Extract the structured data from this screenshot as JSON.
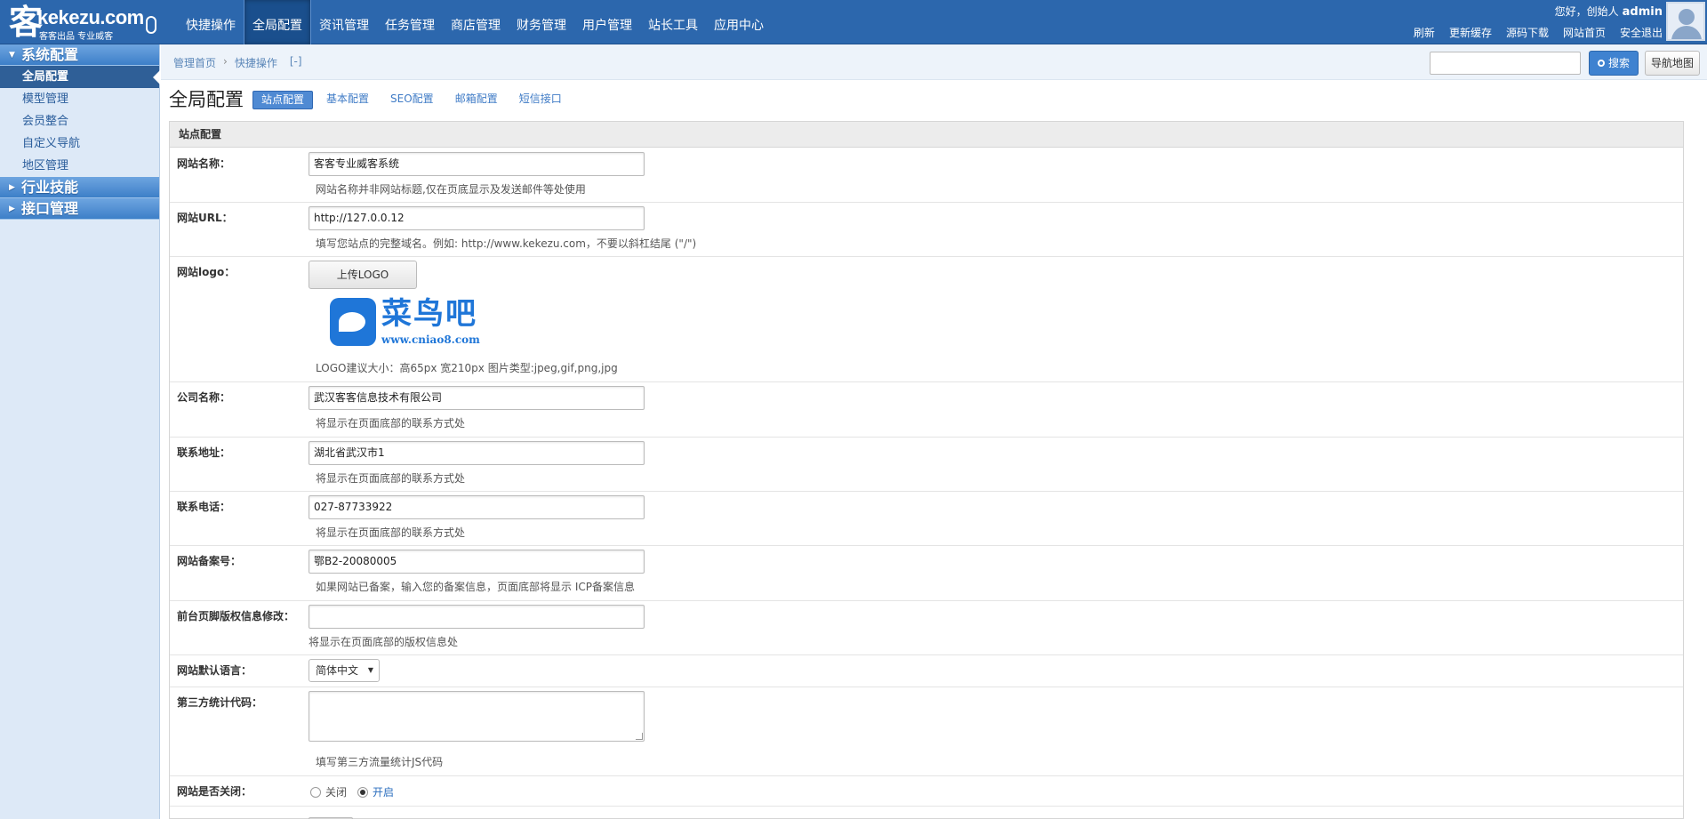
{
  "header": {
    "logo": {
      "glyph": "客",
      "name": "kekezu.com",
      "slogan": "客客出品 专业威客"
    },
    "nav": [
      {
        "label": "快捷操作",
        "active": false
      },
      {
        "label": "全局配置",
        "active": true
      },
      {
        "label": "资讯管理",
        "active": false
      },
      {
        "label": "任务管理",
        "active": false
      },
      {
        "label": "商店管理",
        "active": false
      },
      {
        "label": "财务管理",
        "active": false
      },
      {
        "label": "用户管理",
        "active": false
      },
      {
        "label": "站长工具",
        "active": false
      },
      {
        "label": "应用中心",
        "active": false
      }
    ],
    "user": {
      "greeting": "您好，创始人",
      "username": "admin",
      "links": [
        "刷新",
        "更新缓存",
        "源码下载",
        "网站首页",
        "安全退出"
      ]
    }
  },
  "sidebar": {
    "groups": [
      {
        "label": "系统配置",
        "expanded": true,
        "items": [
          {
            "label": "全局配置",
            "active": true
          },
          {
            "label": "模型管理",
            "active": false
          },
          {
            "label": "会员整合",
            "active": false
          },
          {
            "label": "自定义导航",
            "active": false
          },
          {
            "label": "地区管理",
            "active": false
          }
        ]
      },
      {
        "label": "行业技能",
        "expanded": false,
        "items": []
      },
      {
        "label": "接口管理",
        "expanded": false,
        "items": []
      }
    ]
  },
  "breadcrumb": {
    "home": "管理首页",
    "current": "快捷操作",
    "toggle": "[-]"
  },
  "search": {
    "placeholder": "",
    "button": "搜索",
    "navmap": "导航地图"
  },
  "page": {
    "title": "全局配置",
    "tabs": [
      {
        "label": "站点配置",
        "active": true
      },
      {
        "label": "基本配置",
        "active": false
      },
      {
        "label": "SEO配置",
        "active": false
      },
      {
        "label": "邮箱配置",
        "active": false
      },
      {
        "label": "短信接口",
        "active": false
      }
    ],
    "panel_title": "站点配置"
  },
  "form": {
    "site_name": {
      "label": "网站名称：",
      "value": "客客专业威客系统",
      "hint": "网站名称并非网站标题,仅在页底显示及发送邮件等处使用"
    },
    "site_url": {
      "label": "网站URL：",
      "value": "http://127.0.0.12",
      "hint": "填写您站点的完整域名。例如: http://www.kekezu.com，不要以斜杠结尾 (\"/\")"
    },
    "site_logo": {
      "label": "网站logo：",
      "button": "上传LOGO",
      "preview_brand": "菜鸟吧",
      "preview_url": "www.cniao8.com",
      "hint": "LOGO建议大小：高65px 宽210px 图片类型:jpeg,gif,png,jpg"
    },
    "company": {
      "label": "公司名称：",
      "value": "武汉客客信息技术有限公司",
      "hint": "将显示在页面底部的联系方式处"
    },
    "address": {
      "label": "联系地址：",
      "value": "湖北省武汉市1",
      "hint": "将显示在页面底部的联系方式处"
    },
    "phone": {
      "label": "联系电话：",
      "value": "027-87733922",
      "hint": "将显示在页面底部的联系方式处"
    },
    "icp": {
      "label": "网站备案号：",
      "value": "鄂B2-20080005",
      "hint": "如果网站已备案，输入您的备案信息，页面底部将显示 ICP备案信息"
    },
    "copyright": {
      "label": "前台页脚版权信息修改：",
      "value": "",
      "hint": "将显示在页面底部的版权信息处"
    },
    "language": {
      "label": "网站默认语言：",
      "value": "简体中文"
    },
    "stats_code": {
      "label": "第三方统计代码：",
      "value": "",
      "hint": "填写第三方流量统计JS代码"
    },
    "site_closed": {
      "label": "网站是否关闭：",
      "options": [
        {
          "label": "关闭",
          "selected": false
        },
        {
          "label": "开启",
          "selected": true
        }
      ]
    }
  }
}
